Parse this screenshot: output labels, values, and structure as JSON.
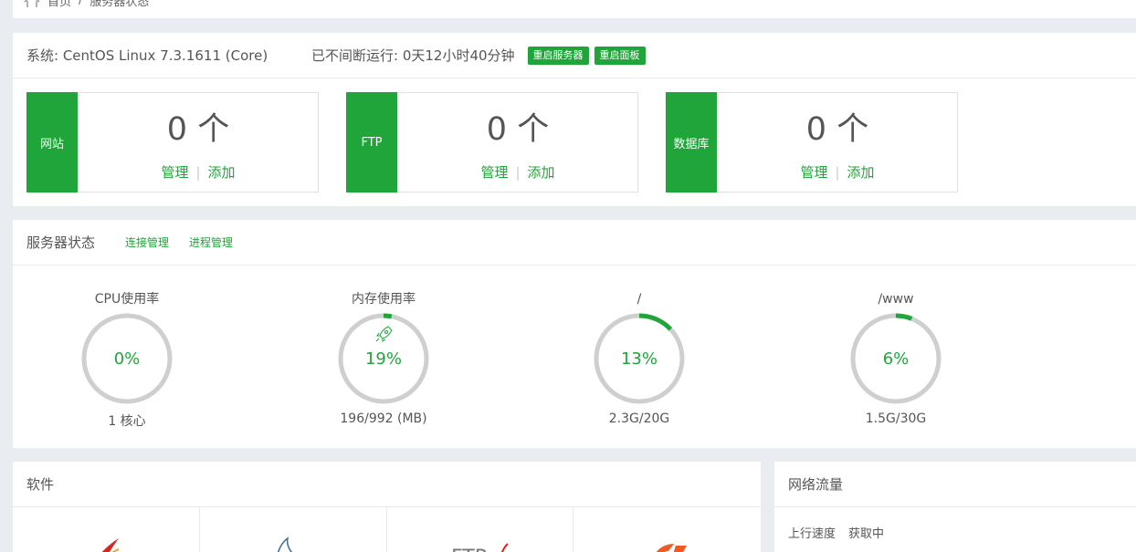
{
  "breadcrumb": {
    "home": "首页",
    "sep": "/",
    "current": "服务器状态"
  },
  "system": {
    "os": "系统: CentOS Linux 7.3.1611 (Core)",
    "uptime": "已不间断运行: 0天12小时40分钟",
    "restart_server": "重启服务器",
    "restart_panel": "重启面板"
  },
  "cards": [
    {
      "name": "网站",
      "count": "0 个",
      "manage": "管理",
      "sep": "|",
      "add": "添加"
    },
    {
      "name": "FTP",
      "count": "0 个",
      "manage": "管理",
      "sep": "|",
      "add": "添加"
    },
    {
      "name": "数据库",
      "count": "0 个",
      "manage": "管理",
      "sep": "|",
      "add": "添加"
    }
  ],
  "status": {
    "title": "服务器状态",
    "link_conn": "连接管理",
    "link_proc": "进程管理",
    "gauges": [
      {
        "title": "CPU使用率",
        "value": "0%",
        "percent": 0,
        "sub": "1 核心"
      },
      {
        "title": "内存使用率",
        "value": "19%",
        "percent": 3,
        "sub": "196/992 (MB)",
        "icon": "rocket-icon"
      },
      {
        "title": "/",
        "value": "13%",
        "percent": 13,
        "sub": "2.3G/20G"
      },
      {
        "title": "/www",
        "value": "6%",
        "percent": 6,
        "sub": "1.5G/30G"
      }
    ]
  },
  "software": {
    "title": "软件"
  },
  "network": {
    "title": "网络流量",
    "up_label": "上行速度",
    "up_value": "获取中"
  },
  "colors": {
    "accent": "#20a53a",
    "track": "#cdd0cd"
  }
}
